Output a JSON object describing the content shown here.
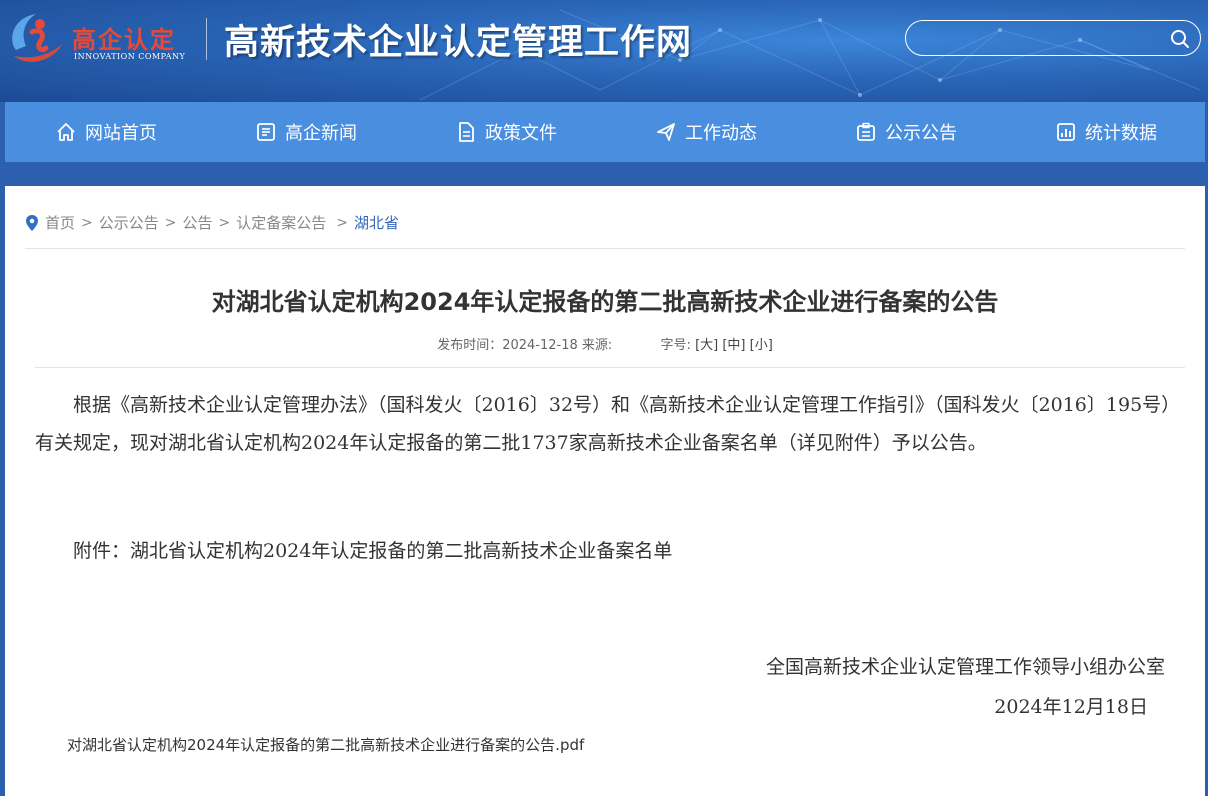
{
  "header": {
    "logo_name": "高企认定",
    "logo_sub": "INNOVATION COMPANY",
    "site_title": "高新技术企业认定管理工作网",
    "search_placeholder": ""
  },
  "nav": [
    {
      "label": "网站首页",
      "icon": "home-icon"
    },
    {
      "label": "高企新闻",
      "icon": "news-icon"
    },
    {
      "label": "政策文件",
      "icon": "document-icon"
    },
    {
      "label": "工作动态",
      "icon": "send-icon"
    },
    {
      "label": "公示公告",
      "icon": "notice-icon"
    },
    {
      "label": "统计数据",
      "icon": "chart-icon"
    }
  ],
  "breadcrumb": [
    "首页",
    "公示公告",
    "公告",
    "认定备案公告",
    "湖北省"
  ],
  "article": {
    "title": "对湖北省认定机构2024年认定报备的第二批高新技术企业进行备案的公告",
    "publish_label": "发布时间：2024-12-18 来源:",
    "fontsize_label": "字号:",
    "fs_large": "[大]",
    "fs_medium": "[中]",
    "fs_small": "[小]",
    "body": "根据《高新技术企业认定管理办法》（国科发火〔2016〕32号）和《高新技术企业认定管理工作指引》（国科发火〔2016〕195号）有关规定，现对湖北省认定机构2024年认定报备的第二批1737家高新技术企业备案名单（详见附件）予以公告。",
    "attachment": "附件：湖北省认定机构2024年认定报备的第二批高新技术企业备案名单",
    "signature_org": "全国高新技术企业认定管理工作领导小组办公室",
    "signature_date": "2024年12月18日",
    "pdf_link": "对湖北省认定机构2024年认定报备的第二批高新技术企业进行备案的公告.pdf"
  },
  "colors": {
    "nav_bg": "#4a8ee0",
    "header_bg": "#2a65b7",
    "logo_red": "#e34a3a",
    "crumb_current": "#3566b5"
  }
}
